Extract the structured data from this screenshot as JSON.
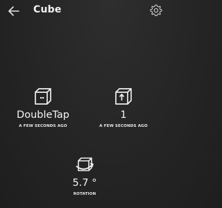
{
  "header": {
    "title": "Cube",
    "back_icon": "arrow-left-icon",
    "settings_icon": "gear-icon"
  },
  "tiles": [
    {
      "icon": "cube-double-tap-icon",
      "value": "DoubleTap",
      "caption": "A FEW SECONDS AGO"
    },
    {
      "icon": "cube-flip-icon",
      "value": "1",
      "caption": "A FEW SECONDS AGO"
    },
    {
      "icon": "cube-rotation-icon",
      "value": "5.7 °",
      "caption": "ROTATION"
    }
  ],
  "colors": {
    "background": "#262626",
    "text": "#f2f2f2"
  }
}
